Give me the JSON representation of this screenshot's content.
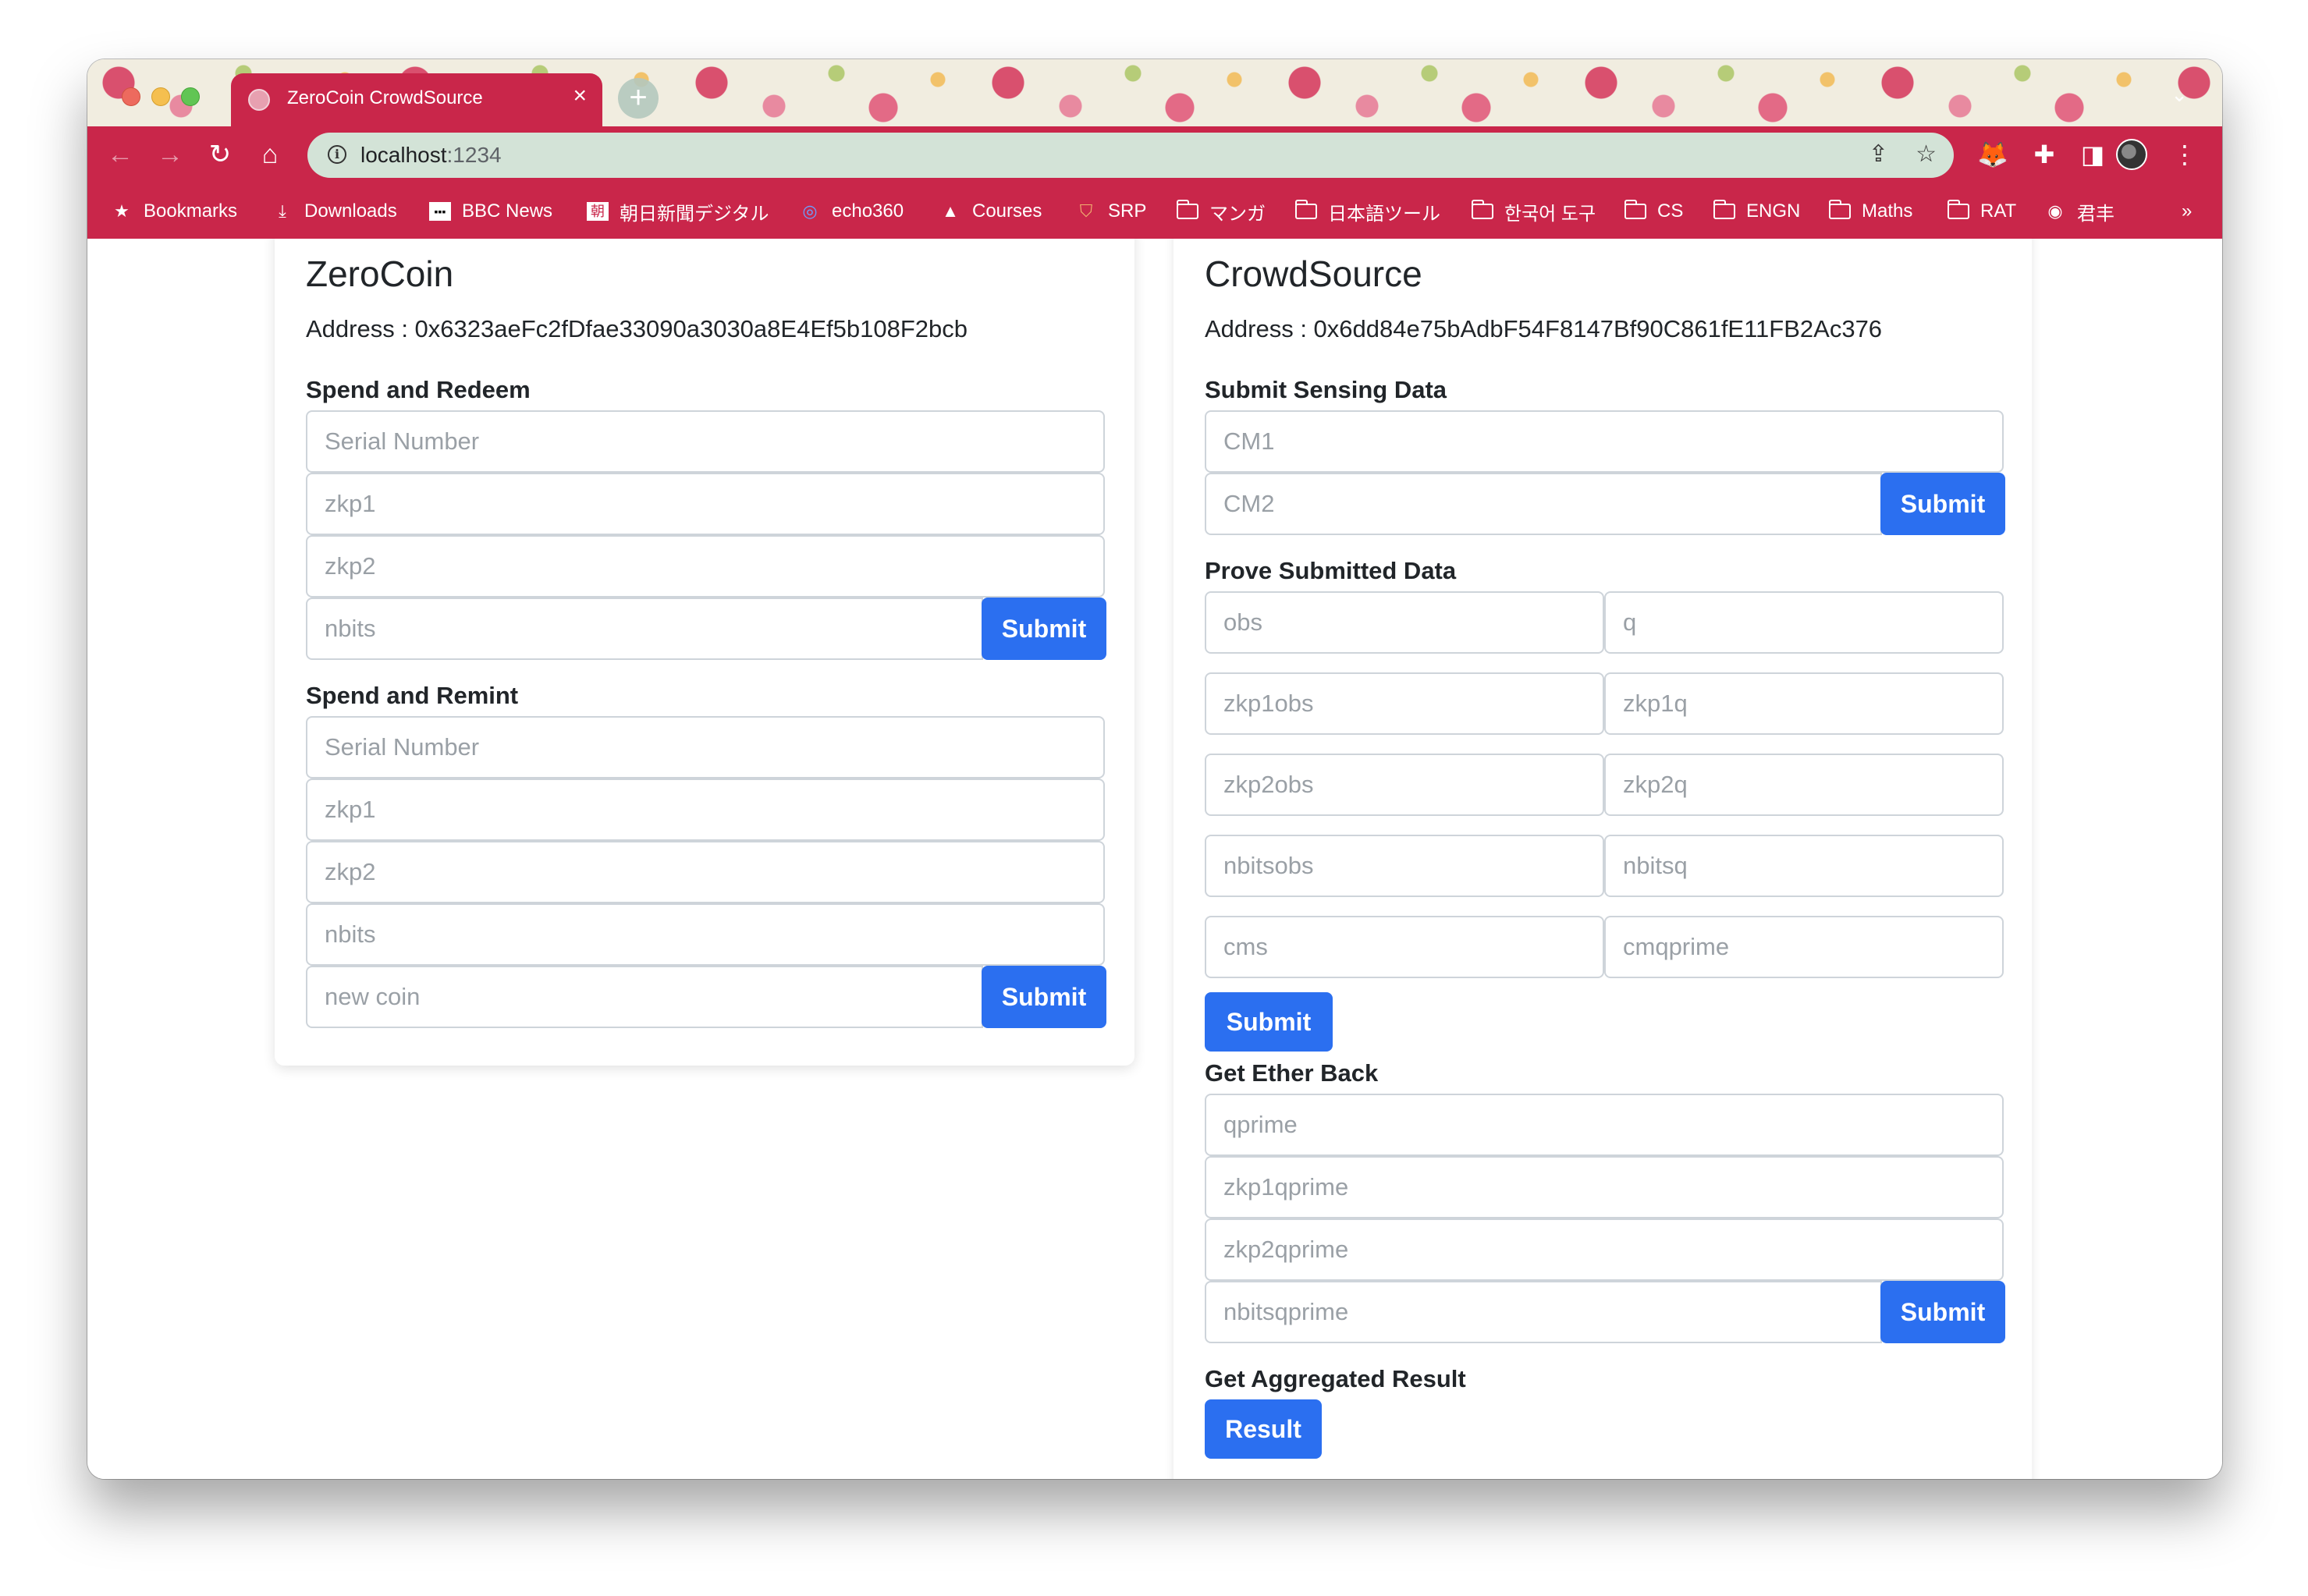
{
  "browser": {
    "tab_title": "ZeroCoin CrowdSource",
    "tab_close": "×",
    "new_tab": "+",
    "url_host": "localhost",
    "url_port": ":1234",
    "theme_color": "#c9264a",
    "bookmarks": [
      {
        "label": "Bookmarks",
        "icon": "star-icon"
      },
      {
        "label": "Downloads",
        "icon": "download-icon"
      },
      {
        "label": "BBC News",
        "icon": "bbc-icon"
      },
      {
        "label": "朝日新聞デジタル",
        "icon": "asahi-icon"
      },
      {
        "label": "echo360",
        "icon": "echo360-icon"
      },
      {
        "label": "Courses",
        "icon": "courses-icon"
      },
      {
        "label": "SRP",
        "icon": "shield-icon"
      },
      {
        "label": "マンガ",
        "icon": "folder-icon"
      },
      {
        "label": "日本語ツール",
        "icon": "folder-icon"
      },
      {
        "label": "한국어 도구",
        "icon": "folder-icon"
      },
      {
        "label": "CS",
        "icon": "folder-icon"
      },
      {
        "label": "ENGN",
        "icon": "folder-icon"
      },
      {
        "label": "Maths",
        "icon": "folder-icon"
      },
      {
        "label": "RAT",
        "icon": "folder-icon"
      },
      {
        "label": "君丰",
        "icon": "globe-icon"
      }
    ],
    "bookmarks_overflow": "»"
  },
  "zerocoin": {
    "title": "ZeroCoin",
    "address": "Address : 0x6323aeFc2fDfae33090a3030a8E4Ef5b108F2bcb",
    "redeem": {
      "heading": "Spend and Redeem",
      "fields": [
        "Serial Number",
        "zkp1",
        "zkp2",
        "nbits"
      ],
      "submit": "Submit"
    },
    "remint": {
      "heading": "Spend and Remint",
      "fields": [
        "Serial Number",
        "zkp1",
        "zkp2",
        "nbits",
        "new coin"
      ],
      "submit": "Submit"
    }
  },
  "crowdsource": {
    "title": "CrowdSource",
    "address": "Address : 0x6dd84e75bAdbF54F8147Bf90C861fE11FB2Ac376",
    "sensing": {
      "heading": "Submit Sensing Data",
      "fields": [
        "CM1",
        "CM2"
      ],
      "submit": "Submit"
    },
    "prove": {
      "heading": "Prove Submitted Data",
      "fields": [
        "obs",
        "q",
        "zkp1obs",
        "zkp1q",
        "zkp2obs",
        "zkp2q",
        "nbitsobs",
        "nbitsq",
        "cms",
        "cmqprime"
      ],
      "submit": "Submit"
    },
    "ether": {
      "heading": "Get Ether Back",
      "fields": [
        "qprime",
        "zkp1qprime",
        "zkp2qprime",
        "nbitsqprime"
      ],
      "submit": "Submit"
    },
    "aggregate": {
      "heading": "Get Aggregated Result",
      "button": "Result"
    }
  }
}
